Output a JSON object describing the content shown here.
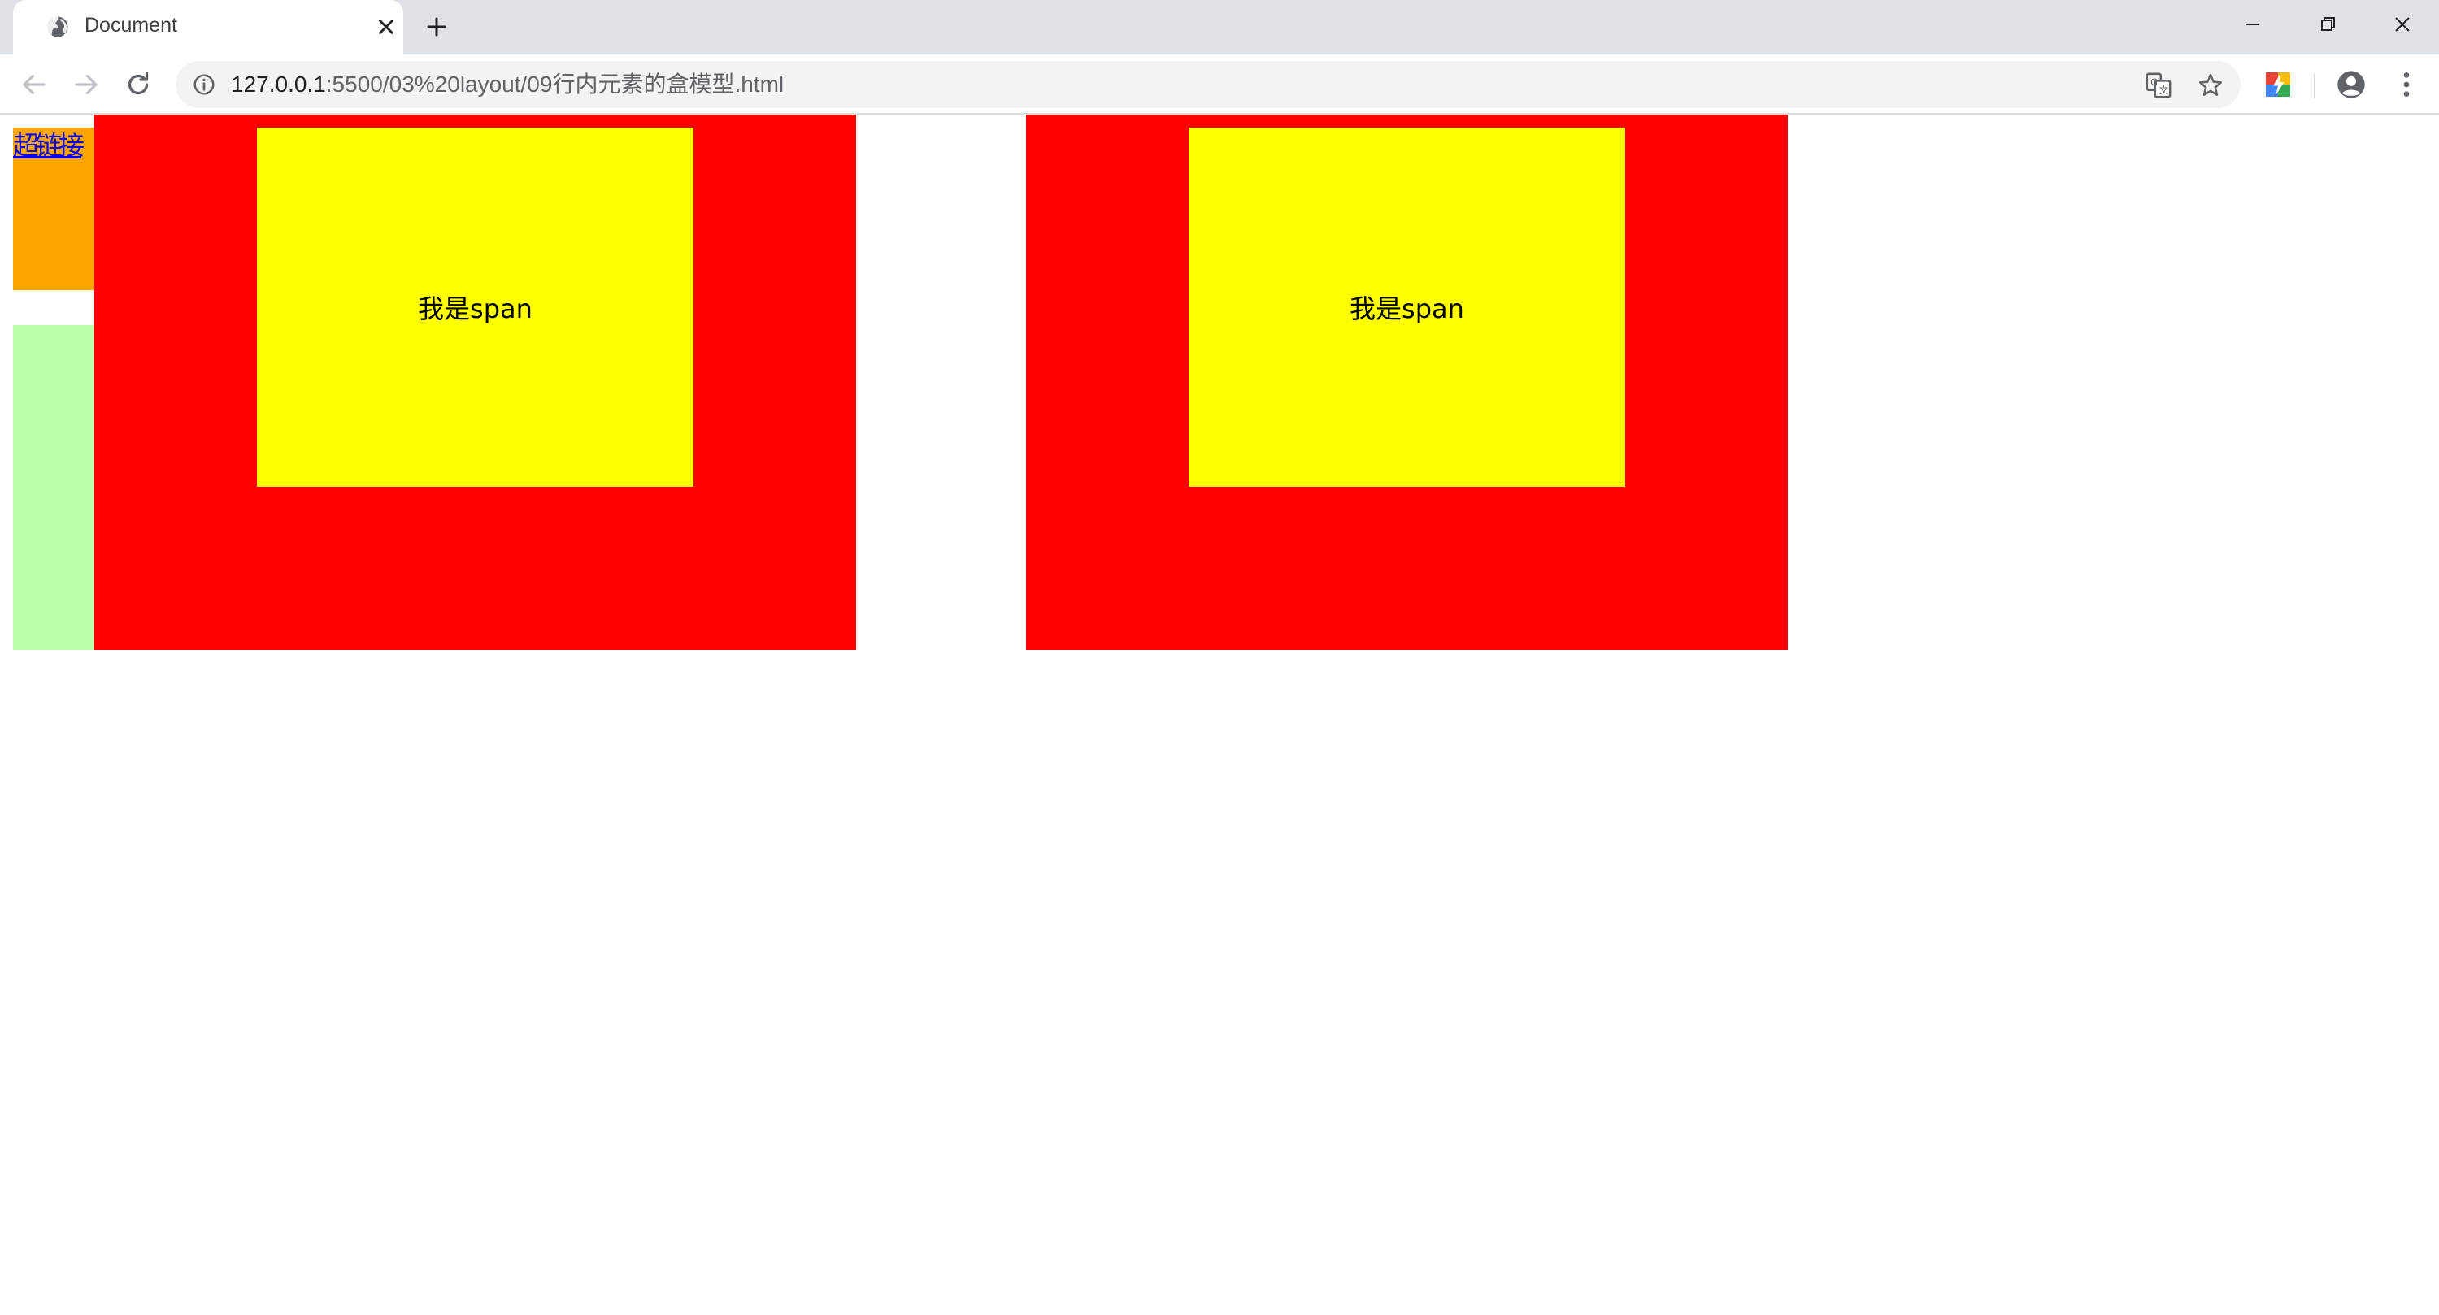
{
  "browser": {
    "tab": {
      "title": "Document"
    },
    "address_bar": {
      "host": "127.0.0.1",
      "path": ":5500/03%20layout/09行内元素的盒模型.html"
    }
  },
  "page": {
    "link_text": "超链接",
    "span_boxes": [
      {
        "text": "我是span"
      },
      {
        "text": "我是span"
      }
    ],
    "colors": {
      "orange": "#ffa500",
      "green": "#bbffaa",
      "red": "#ff0000",
      "yellow": "#ffff00",
      "link": "#0000ee"
    }
  },
  "icons": {
    "tab_favicon": "globe-icon",
    "tab_close": "close-icon",
    "new_tab": "plus-icon",
    "back": "arrow-left-icon",
    "forward": "arrow-right-icon",
    "reload": "reload-icon",
    "site_info": "info-icon",
    "translate": "translate-icon",
    "bookmark": "star-icon",
    "extension": "extension-icon",
    "profile": "account-icon",
    "menu": "kebab-menu-icon"
  }
}
